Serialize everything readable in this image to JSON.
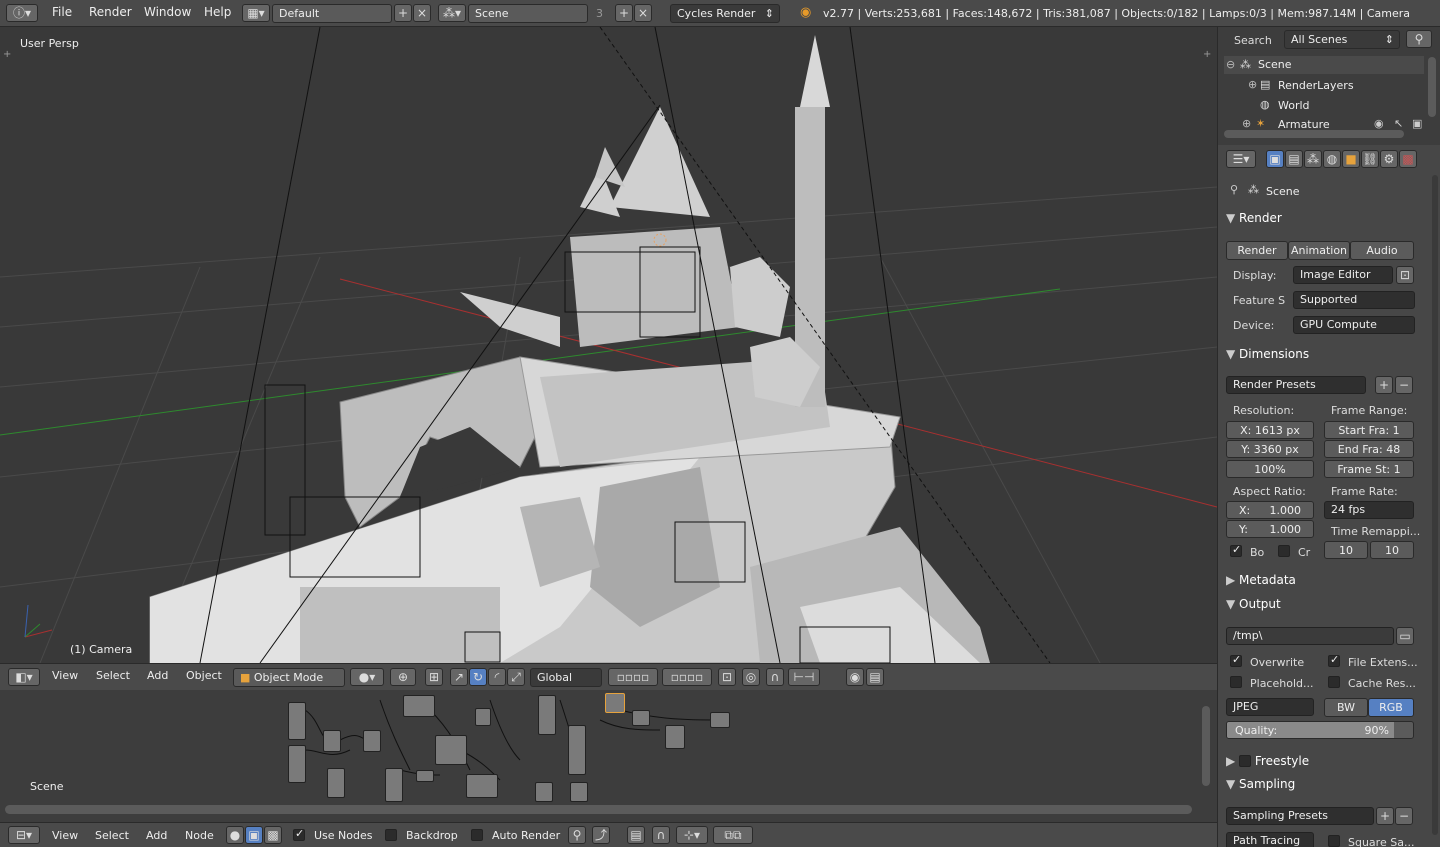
{
  "topbar": {
    "menu": [
      "File",
      "Render",
      "Window",
      "Help"
    ],
    "layout": "Default",
    "scene": "Scene",
    "scene_users": "3",
    "engine": "Cycles Render",
    "stats": "v2.77 | Verts:253,681 | Faces:148,672 | Tris:381,087 | Objects:0/182 | Lamps:0/3 | Mem:987.14M | Camera"
  },
  "viewport": {
    "label": "User Persp",
    "object_name": "(1) Camera"
  },
  "viewport_toolbar": {
    "menus": [
      "View",
      "Select",
      "Add",
      "Object"
    ],
    "mode": "Object Mode",
    "orientation": "Global"
  },
  "node_editor": {
    "label": "Scene",
    "menus": [
      "View",
      "Select",
      "Add",
      "Node"
    ],
    "use_nodes": "Use Nodes",
    "backdrop": "Backdrop",
    "auto_render": "Auto Render"
  },
  "outliner": {
    "search_label": "Search",
    "filter": "All Scenes",
    "items": [
      "Scene",
      "RenderLayers",
      "World",
      "Armature"
    ]
  },
  "properties": {
    "context": "Scene",
    "render": {
      "title": "Render",
      "buttons": [
        "Render",
        "Animation",
        "Audio"
      ],
      "display_label": "Display:",
      "display_value": "Image Editor",
      "feature_label": "Feature S",
      "feature_value": "Supported",
      "device_label": "Device:",
      "device_value": "GPU Compute"
    },
    "dimensions": {
      "title": "Dimensions",
      "presets": "Render Presets",
      "resolution_label": "Resolution:",
      "res_x": "X: 1613 px",
      "res_y": "Y: 3360 px",
      "res_pct": "100%",
      "frame_range_label": "Frame Range:",
      "start": "Start Fra:  1",
      "end": "End Fra:  48",
      "step": "Frame St:  1",
      "aspect_label": "Aspect Ratio:",
      "aspect_x_label": "X:",
      "aspect_x": "1.000",
      "aspect_y_label": "Y:",
      "aspect_y": "1.000",
      "frame_rate_label": "Frame Rate:",
      "fps": "24 fps",
      "time_remap_label": "Time Remappi...",
      "remap_old": "10",
      "remap_new": "10",
      "border_label": "Bo",
      "crop_label": "Cr"
    },
    "metadata": {
      "title": "Metadata"
    },
    "output": {
      "title": "Output",
      "path": "/tmp\\",
      "overwrite": "Overwrite",
      "file_ext": "File Extens...",
      "placeholders": "Placehold...",
      "cache": "Cache Res...",
      "format": "JPEG",
      "bw": "BW",
      "rgb": "RGB",
      "quality_label": "Quality:",
      "quality_value": "90%",
      "quality": 0.9
    },
    "freestyle": {
      "title": "Freestyle"
    },
    "sampling": {
      "title": "Sampling",
      "presets": "Sampling Presets",
      "integrator": "Path Tracing",
      "square": "Square Sa..."
    }
  },
  "colors": {
    "grid_x_axis": "#a83030",
    "grid_y_axis": "#2e8a2e",
    "selected_blue": "#5680c2"
  }
}
